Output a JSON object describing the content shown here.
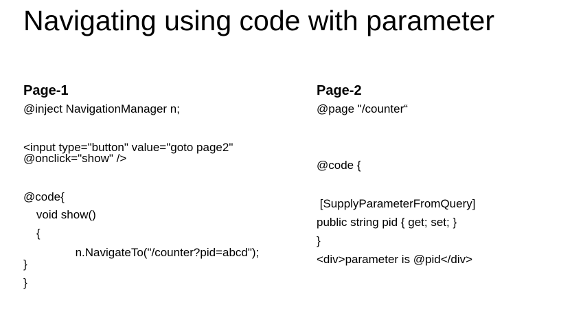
{
  "slide": {
    "title": "Navigating using code with parameter"
  },
  "left": {
    "heading": "Page-1",
    "lines": [
      "@inject NavigationManager n;",
      "<input type=\"button\" value=\"goto page2\"",
      "@onclick=\"show\" />",
      "@code{",
      "    void show()",
      "    {",
      "                n.NavigateTo(\"/counter?pid=abcd\");",
      "}",
      "}"
    ]
  },
  "right": {
    "heading": "Page-2",
    "lines": [
      "@page \"/counter“",
      "@code {",
      " [SupplyParameterFromQuery]",
      "public string pid { get; set; }",
      "}",
      "<div>parameter is @pid</div>"
    ]
  }
}
